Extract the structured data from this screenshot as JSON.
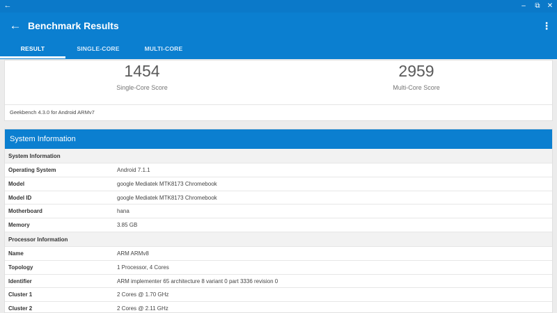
{
  "window": {
    "back_glyph": "←",
    "min_glyph": "–",
    "restore_glyph": "⧉",
    "close_glyph": "✕"
  },
  "appbar": {
    "back_glyph": "←",
    "title": "Benchmark Results",
    "menu_glyph": "⋮"
  },
  "tabs": [
    {
      "label": "RESULT",
      "active": true
    },
    {
      "label": "SINGLE-CORE",
      "active": false
    },
    {
      "label": "MULTI-CORE",
      "active": false
    }
  ],
  "scores": {
    "single": {
      "value": "1454",
      "label": "Single-Core Score"
    },
    "multi": {
      "value": "2959",
      "label": "Multi-Core Score"
    },
    "version": "Geekbench 4.3.0 for Android ARMv7"
  },
  "system_card": {
    "title": "System Information",
    "sections": [
      {
        "heading": "System Information",
        "rows": [
          {
            "key": "Operating System",
            "value": "Android 7.1.1"
          },
          {
            "key": "Model",
            "value": "google Mediatek MTK8173 Chromebook"
          },
          {
            "key": "Model ID",
            "value": "google Mediatek MTK8173 Chromebook"
          },
          {
            "key": "Motherboard",
            "value": "hana"
          },
          {
            "key": "Memory",
            "value": "3.85 GB"
          }
        ]
      },
      {
        "heading": "Processor Information",
        "rows": [
          {
            "key": "Name",
            "value": "ARM ARMv8"
          },
          {
            "key": "Topology",
            "value": "1 Processor, 4 Cores"
          },
          {
            "key": "Identifier",
            "value": "ARM implementer 65 architecture 8 variant 0 part 3336 revision 0"
          },
          {
            "key": "Cluster 1",
            "value": "2 Cores @ 1.70 GHz"
          },
          {
            "key": "Cluster 2",
            "value": "2 Cores @ 2.11 GHz"
          }
        ]
      }
    ]
  },
  "colors": {
    "primary": "#0b7fd0",
    "chrome": "#0b79c9",
    "background": "#ececec"
  }
}
